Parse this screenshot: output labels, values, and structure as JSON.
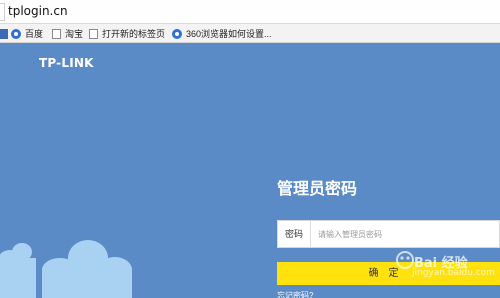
{
  "browser": {
    "url": "tplogin.cn"
  },
  "bookmarks": [
    {
      "label": "百度",
      "icon": "baidu-paw-icon"
    },
    {
      "label": "淘宝",
      "icon": "document-icon"
    },
    {
      "label": "打开新的标签页",
      "icon": "document-icon"
    },
    {
      "label": "360浏览器如何设置...",
      "icon": "paw-icon"
    }
  ],
  "page": {
    "logo": "TP-LINK",
    "title": "管理员密码",
    "password_label": "密码",
    "password_placeholder": "请输入管理员密码",
    "confirm_label": "确定",
    "forgot_label": "忘记密码?"
  },
  "colors": {
    "background": "#5b8bc7",
    "button": "#ffe20d",
    "cloud": "#a9d2f2"
  },
  "watermark": {
    "text": "Bai 经验",
    "sub": "jingyan.baidu.com"
  }
}
